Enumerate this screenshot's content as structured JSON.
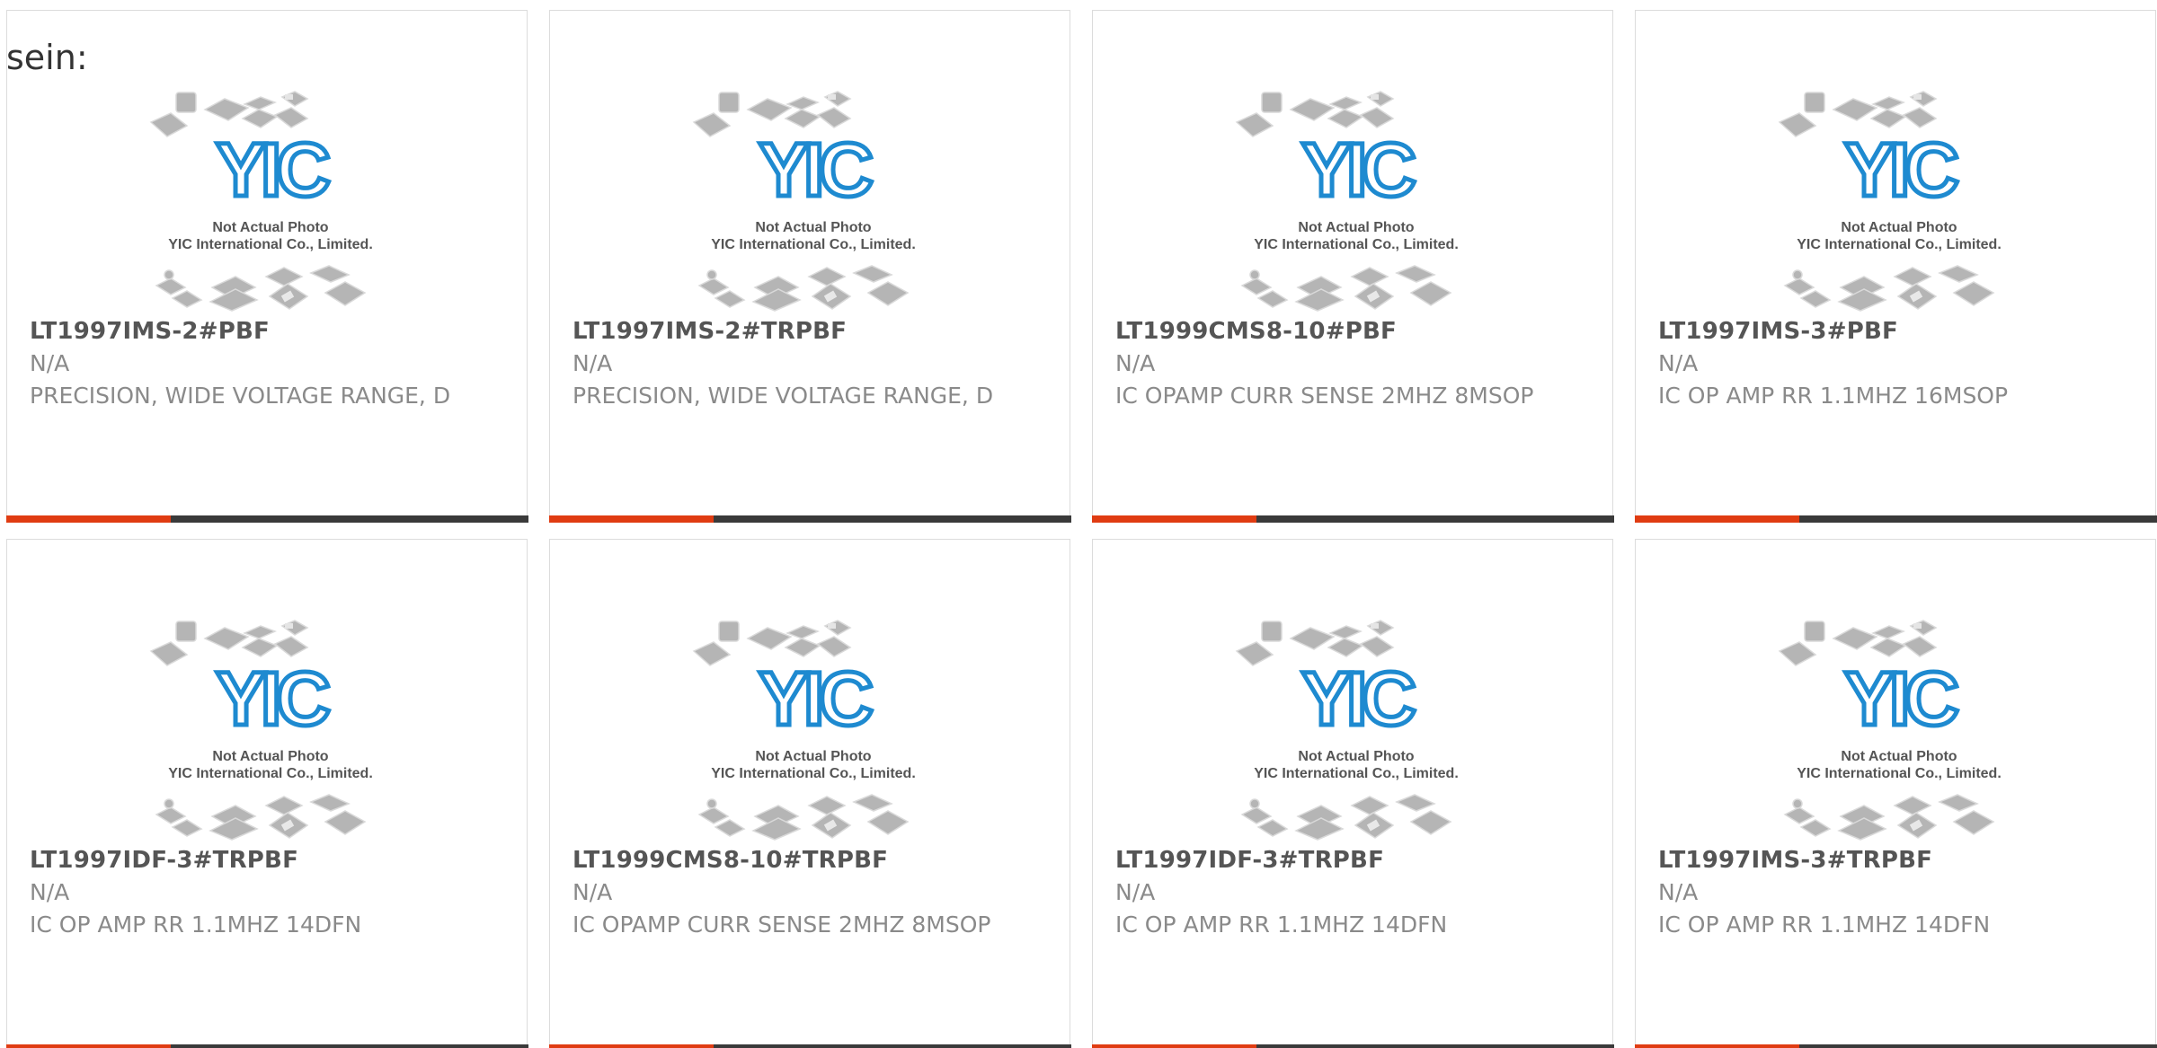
{
  "page": {
    "prefix_text": "sein:"
  },
  "thumbnail": {
    "logo_text": "YIC",
    "caption_line1": "Not Actual Photo",
    "caption_line2": "YIC International Co., Limited."
  },
  "colors": {
    "accent": "#e03c12",
    "bar": "#3a3a3a",
    "logo": "#1e8ad0",
    "title": "#555555",
    "text": "#8a8a8a"
  },
  "products": [
    {
      "part_number": "LT1997IMS-2#PBF",
      "manufacturer": "N/A",
      "description": "PRECISION, WIDE VOLTAGE RANGE, D"
    },
    {
      "part_number": "LT1997IMS-2#TRPBF",
      "manufacturer": "N/A",
      "description": "PRECISION, WIDE VOLTAGE RANGE, D"
    },
    {
      "part_number": "LT1999CMS8-10#PBF",
      "manufacturer": "N/A",
      "description": "IC OPAMP CURR SENSE 2MHZ 8MSOP"
    },
    {
      "part_number": "LT1997IMS-3#PBF",
      "manufacturer": "N/A",
      "description": "IC OP AMP RR 1.1MHZ 16MSOP"
    },
    {
      "part_number": "LT1997IDF-3#TRPBF",
      "manufacturer": "N/A",
      "description": "IC OP AMP RR 1.1MHZ 14DFN"
    },
    {
      "part_number": "LT1999CMS8-10#TRPBF",
      "manufacturer": "N/A",
      "description": "IC OPAMP CURR SENSE 2MHZ 8MSOP"
    },
    {
      "part_number": "LT1997IDF-3#TRPBF",
      "manufacturer": "N/A",
      "description": "IC OP AMP RR 1.1MHZ 14DFN"
    },
    {
      "part_number": "LT1997IMS-3#TRPBF",
      "manufacturer": "N/A",
      "description": "IC OP AMP RR 1.1MHZ 14DFN"
    }
  ]
}
